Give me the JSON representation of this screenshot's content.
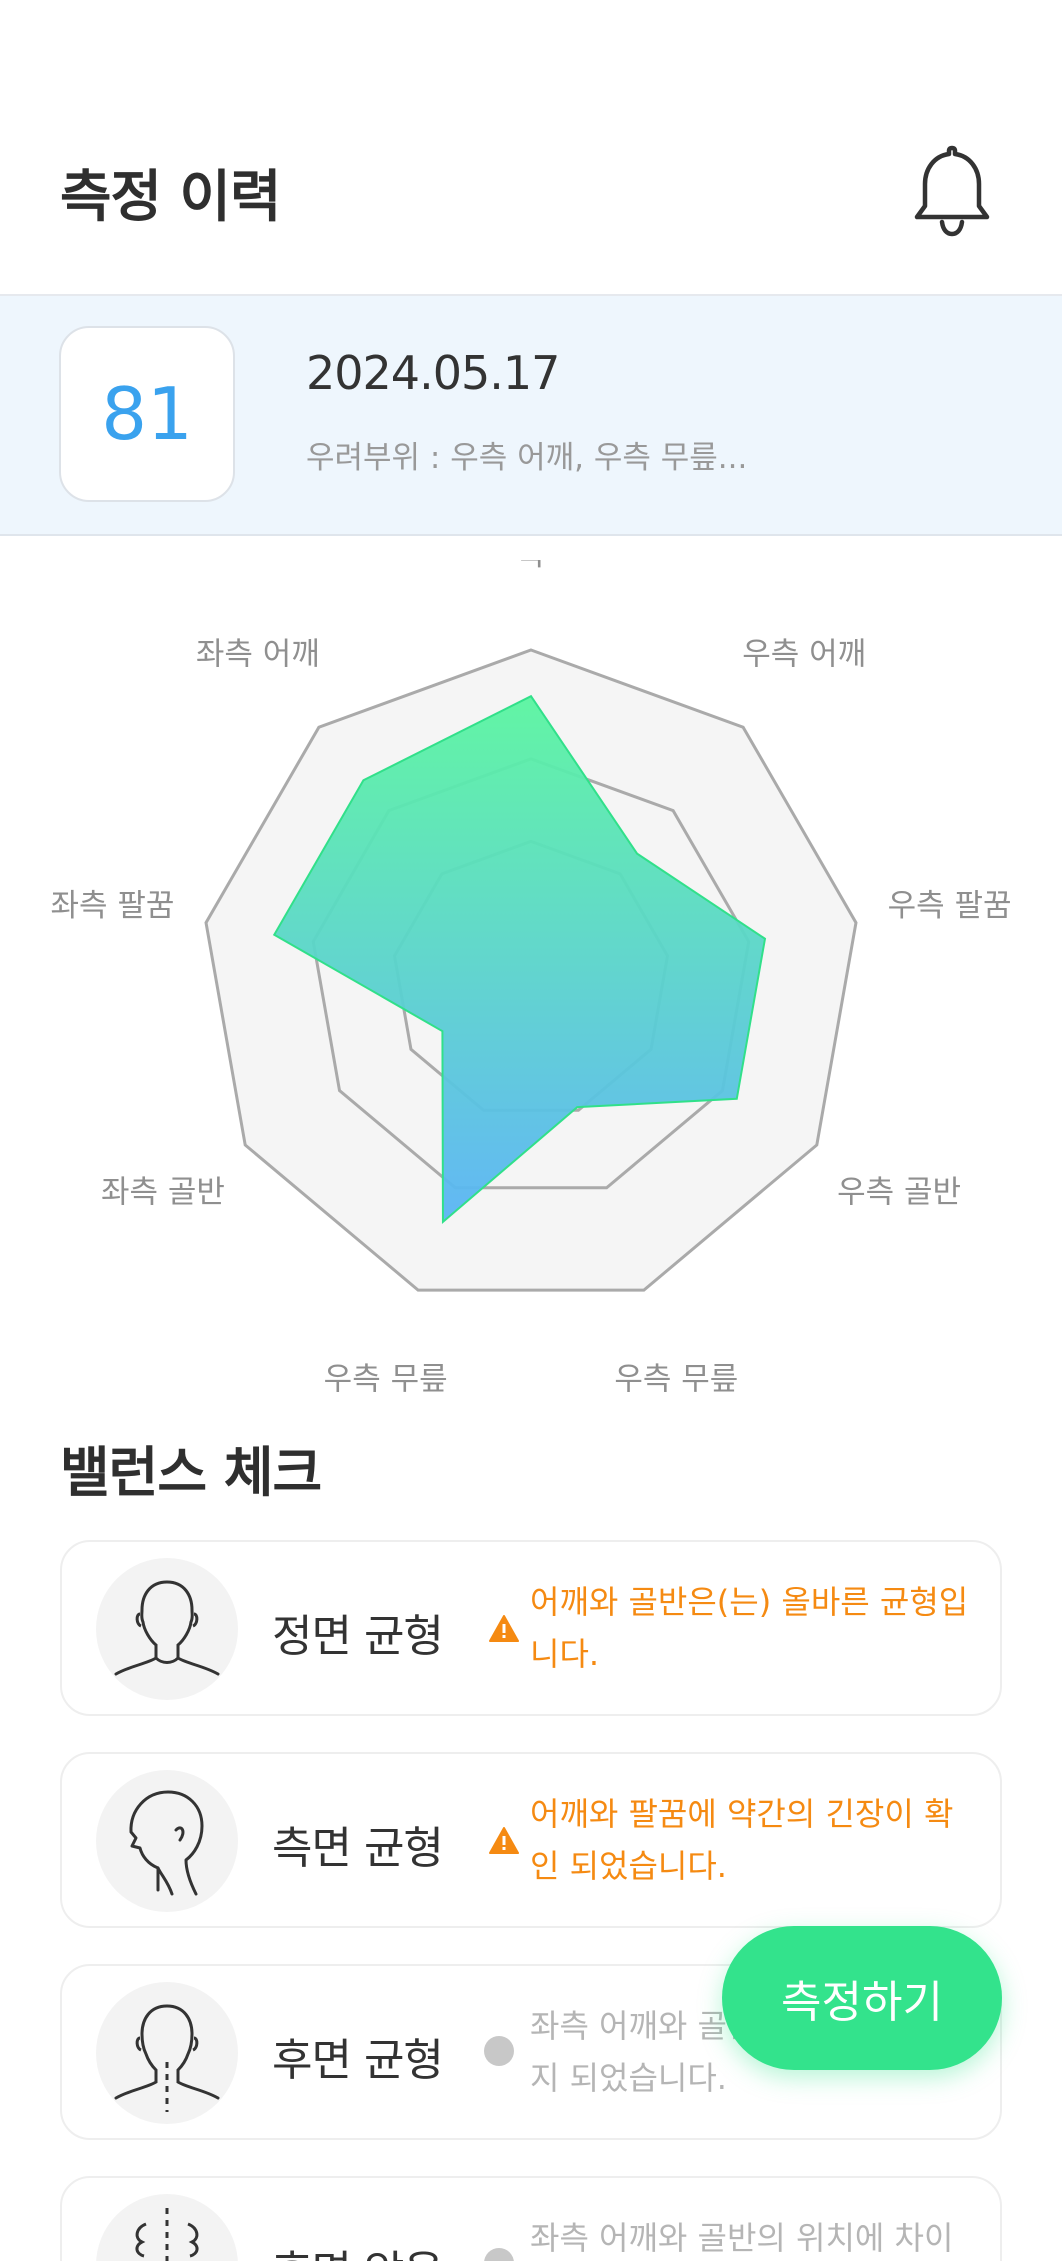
{
  "header": {
    "title": "측정 이력",
    "bell_icon": "bell-icon"
  },
  "record": {
    "score": "81",
    "date": "2024.05.17",
    "concern": "우려부위 : 우측 어깨, 우측 무릎..."
  },
  "chart_data": {
    "type": "radar",
    "categories": [
      "목",
      "우측 어깨",
      "우측 팔꿈",
      "우측 골반",
      "우측 무릎",
      "우측 무릎",
      "좌측 골반",
      "좌측 팔꿈",
      "좌측 어깨"
    ],
    "values": [
      0.86,
      0.5,
      0.72,
      0.72,
      0.41,
      0.78,
      0.31,
      0.79,
      0.79
    ],
    "ylim": [
      0,
      1
    ],
    "colors": {
      "top": "#5af5a0",
      "bottom": "#5ab4f5",
      "stroke": "#31e08a",
      "grid": "#aaaaaa",
      "fill": "#f5f5f5"
    }
  },
  "balance": {
    "title": "밸런스 체크",
    "items": [
      {
        "title": "정면 균형",
        "desc": "어깨와 골반은(는) 올바른 균형입니다.",
        "status": "warn",
        "icon": "front-head-icon"
      },
      {
        "title": "측면 균형",
        "desc": "어깨와 팔꿈에 약간의 긴장이 확인 되었습니다.",
        "status": "warn",
        "icon": "side-head-icon"
      },
      {
        "title": "후면 균형",
        "desc": "좌측 어깨와 골반의 불균형이 감지 되었습니다.",
        "status": "neutral",
        "icon": "back-head-icon"
      },
      {
        "title": "후면 앉음",
        "desc": "좌측 어깨와 골반의 위치에 차이",
        "status": "neutral",
        "icon": "spine-icon"
      }
    ]
  },
  "fab": {
    "label": "측정하기"
  },
  "accent": {
    "orange": "#f58a12",
    "green": "#33e38c",
    "blue": "#3aa2ee"
  }
}
